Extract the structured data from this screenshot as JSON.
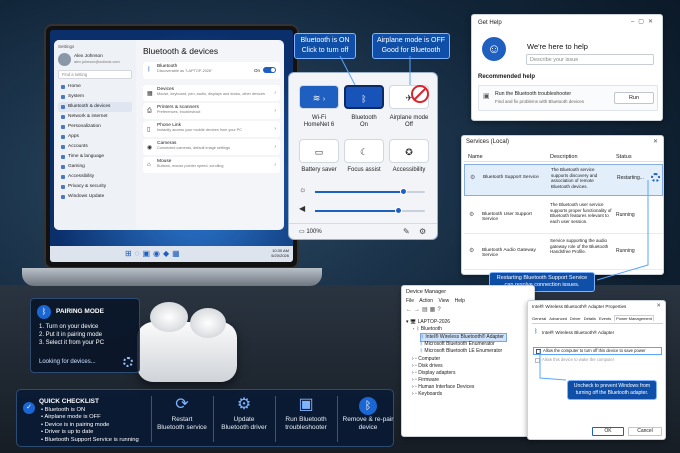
{
  "settings": {
    "window_title": "Settings",
    "user_name": "Alex Johnson",
    "user_email": "alex.johnson@outlook.com",
    "search_placeholder": "Find a setting",
    "nav": [
      "Home",
      "System",
      "Bluetooth & devices",
      "Network & internet",
      "Personalization",
      "Apps",
      "Accounts",
      "Time & language",
      "Gaming",
      "Accessibility",
      "Privacy & security",
      "Windows Update"
    ],
    "page_title": "Bluetooth & devices",
    "bt_title": "Bluetooth",
    "bt_sub": "Discoverable as \"LAPTOP-2026\"",
    "bt_state": "On",
    "cards": [
      {
        "title": "Devices",
        "sub": "Mouse, keyboard, pen, audio, displays and docks, other devices"
      },
      {
        "title": "Printers & scanners",
        "sub": "Preferences, troubleshoot"
      },
      {
        "title": "Phone Link",
        "sub": "Instantly access your mobile devices from your PC"
      },
      {
        "title": "Cameras",
        "sub": "Connected cameras, default image settings"
      },
      {
        "title": "Mouse",
        "sub": "Buttons, mouse pointer speed, scrolling"
      }
    ],
    "taskbar_time": "10:30 AM",
    "taskbar_date": "5/20/2026"
  },
  "callouts": {
    "bt_on": [
      "Bluetooth is ON",
      "Click to turn off"
    ],
    "airplane_off": [
      "Airplane mode is OFF",
      "Good for Bluetooth"
    ],
    "restart": [
      "Restarting Bluetooth Support Service",
      "can resolve connection issues."
    ],
    "uncheck": [
      "Uncheck to prevent Windows from",
      "turning off the Bluetooth adapter."
    ]
  },
  "quick_settings": {
    "wifi_label": "Wi-Fi",
    "wifi_sub": "HomeNet 6",
    "bt_label": "Bluetooth",
    "bt_sub": "On",
    "airplane_label": "Airplane mode",
    "airplane_sub": "Off",
    "battery_saver": "Battery saver",
    "focus_assist": "Focus assist",
    "accessibility": "Accessibility",
    "battery": "100%",
    "brightness_level": 0.8,
    "volume_level": 0.75
  },
  "get_help": {
    "title": "Get Help",
    "heading": "We're here to help",
    "search_placeholder": "Describe your issue",
    "recommended": "Recommended help",
    "rec_title": "Run the Bluetooth troubleshooter",
    "rec_sub": "Find and fix problems with Bluetooth devices",
    "run_label": "Run"
  },
  "services": {
    "title": "Services (Local)",
    "columns": [
      "Name",
      "Description",
      "Status"
    ],
    "rows": [
      {
        "name": "Bluetooth Support Service",
        "desc": "The Bluetooth service supports discovery and association of remote Bluetooth devices.",
        "status": "Restarting..."
      },
      {
        "name": "Bluetooth User Support Service",
        "desc": "The Bluetooth user service supports proper functionality of Bluetooth features relevant to each user session.",
        "status": "Running"
      },
      {
        "name": "Bluetooth Audio Gateway Service",
        "desc": "Service supporting the audio gateway role of the Bluetooth Handsfree Profile.",
        "status": "Running"
      }
    ]
  },
  "device_manager": {
    "title": "Device Manager",
    "menu": [
      "File",
      "Action",
      "View",
      "Help"
    ],
    "root": "LAPTOP-2026",
    "bluetooth": "Bluetooth",
    "bt_children": [
      "Intel® Wireless Bluetooth® Adapter",
      "Microsoft Bluetooth Enumerator",
      "Microsoft Bluetooth LE Enumerator"
    ],
    "categories": [
      "Computer",
      "Disk drives",
      "Display adapters",
      "Firmware",
      "Human Interface Devices",
      "Keyboards"
    ]
  },
  "properties": {
    "title": "Intel® Wireless Bluetooth® Adapter Properties",
    "tabs": [
      "General",
      "Advanced",
      "Driver",
      "Details",
      "Events",
      "Power Management"
    ],
    "device": "Intel® Wireless Bluetooth® Adapter",
    "check1": "Allow the computer to turn off this device to save power",
    "check2": "Allow this device to wake the computer",
    "ok": "OK",
    "cancel": "Cancel"
  },
  "pairing": {
    "title": "PAIRING MODE",
    "steps": [
      "1.  Turn on your device",
      "2.  Put it in pairing mode",
      "3.  Select it from your PC"
    ],
    "status": "Looking for devices..."
  },
  "checklist": {
    "title": "QUICK CHECKLIST",
    "items": [
      "Bluetooth is ON",
      "Airplane mode is OFF",
      "Device is in pairing mode",
      "Driver is up to date",
      "Bluetooth Support Service is running"
    ],
    "actions": [
      {
        "icon": "restart-icon",
        "l1": "Restart",
        "l2": "Bluetooth service"
      },
      {
        "icon": "gear-icon",
        "l1": "Update",
        "l2": "Bluetooth driver"
      },
      {
        "icon": "monitor-icon",
        "l1": "Run Bluetooth",
        "l2": "troubleshooter"
      },
      {
        "icon": "bluetooth-icon",
        "l1": "Remove & re-pair",
        "l2": "device"
      }
    ]
  },
  "colors": {
    "accent": "#1f5fbf",
    "panel_bg": "#0a1a34",
    "callout": "#0f4fa8"
  }
}
